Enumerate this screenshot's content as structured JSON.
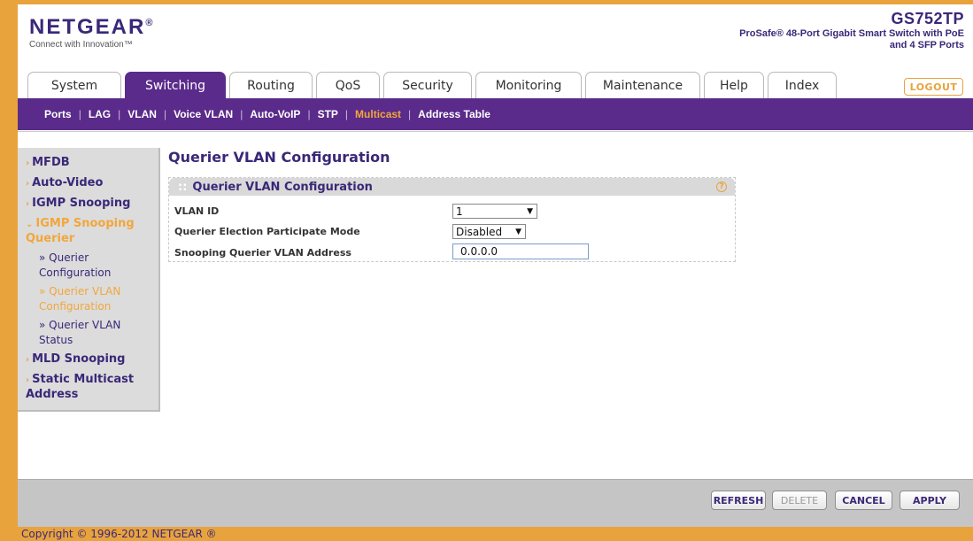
{
  "header": {
    "brand": "NETGEAR",
    "brand_mark": "®",
    "tagline": "Connect with Innovation™",
    "model": "GS752TP",
    "model_desc": "ProSafe® 48-Port Gigabit Smart Switch with PoE and 4 SFP Ports",
    "logout_label": "LOGOUT"
  },
  "tabs": [
    {
      "label": "System"
    },
    {
      "label": "Switching"
    },
    {
      "label": "Routing"
    },
    {
      "label": "QoS"
    },
    {
      "label": "Security"
    },
    {
      "label": "Monitoring"
    },
    {
      "label": "Maintenance"
    },
    {
      "label": "Help"
    },
    {
      "label": "Index"
    }
  ],
  "active_tab": "Switching",
  "subnav": [
    {
      "label": "Ports"
    },
    {
      "label": "LAG"
    },
    {
      "label": "VLAN"
    },
    {
      "label": "Voice VLAN"
    },
    {
      "label": "Auto-VoIP"
    },
    {
      "label": "STP"
    },
    {
      "label": "Multicast"
    },
    {
      "label": "Address Table"
    }
  ],
  "active_subnav": "Multicast",
  "sidebar": {
    "items": [
      {
        "label": "MFDB"
      },
      {
        "label": "Auto-Video"
      },
      {
        "label": "IGMP Snooping"
      },
      {
        "label": "IGMP Snooping Querier"
      },
      {
        "label": "MLD Snooping"
      },
      {
        "label": "Static Multicast Address"
      }
    ],
    "subitems": [
      {
        "label": "Querier Configuration"
      },
      {
        "label": "Querier VLAN Configuration"
      },
      {
        "label": "Querier VLAN Status"
      }
    ]
  },
  "main": {
    "title": "Querier VLAN Configuration",
    "panel_title": "Querier VLAN Configuration",
    "help_icon": "?",
    "fields": {
      "vlan_id_label": "VLAN ID",
      "vlan_id_value": "1",
      "mode_label": "Querier Election Participate Mode",
      "mode_value": "Disabled",
      "address_label": "Snooping Querier VLAN Address",
      "address_value": "0.0.0.0"
    }
  },
  "buttons": {
    "refresh": "REFRESH",
    "delete": "DELETE",
    "cancel": "CANCEL",
    "apply": "APPLY"
  },
  "footer": {
    "copyright": "Copyright © 1996-2012 NETGEAR ®"
  },
  "colors": {
    "brand_purple": "#5a2b8a",
    "accent_orange": "#e8a33d",
    "active_text": "#f2a63c"
  }
}
